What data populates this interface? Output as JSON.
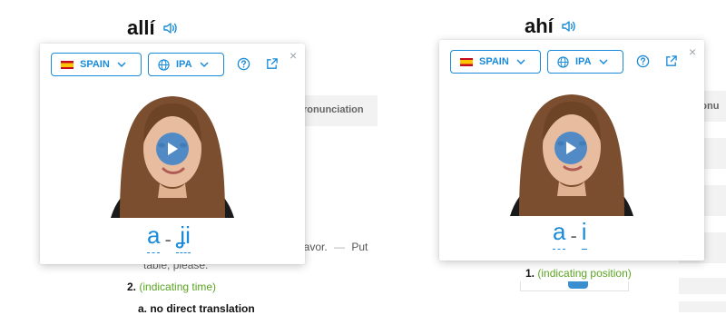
{
  "left": {
    "headword": "allí",
    "popup": {
      "region_label": "SPAIN",
      "notation_label": "IPA",
      "syllables": [
        "a",
        "ʝi"
      ],
      "separator": "-"
    },
    "bg_pronunciation": "ronunciation",
    "bg_example": "r favor.",
    "bg_example_dash": "—",
    "bg_example_en": "Put",
    "bg_example_cont": "table, please.",
    "sense_number": "2.",
    "sense_text": "(indicating time)",
    "sub_sense": "a. no direct translation"
  },
  "right": {
    "headword": "ahí",
    "popup": {
      "region_label": "SPAIN",
      "notation_label": "IPA",
      "syllables": [
        "a",
        "i"
      ],
      "separator": "-"
    },
    "bg_pronunciation": "ronu",
    "sense_number": "1.",
    "sense_text": "(indicating position)"
  },
  "icons": {
    "speaker": "speaker-icon",
    "help": "help-circle-icon",
    "external": "external-link-icon",
    "close": "close-icon",
    "globe": "globe-icon",
    "flag": "spain-flag-icon",
    "play": "play-icon"
  },
  "close_glyph": "×",
  "colors": {
    "accent": "#1a8bd8",
    "sense_green": "#5aa521"
  }
}
